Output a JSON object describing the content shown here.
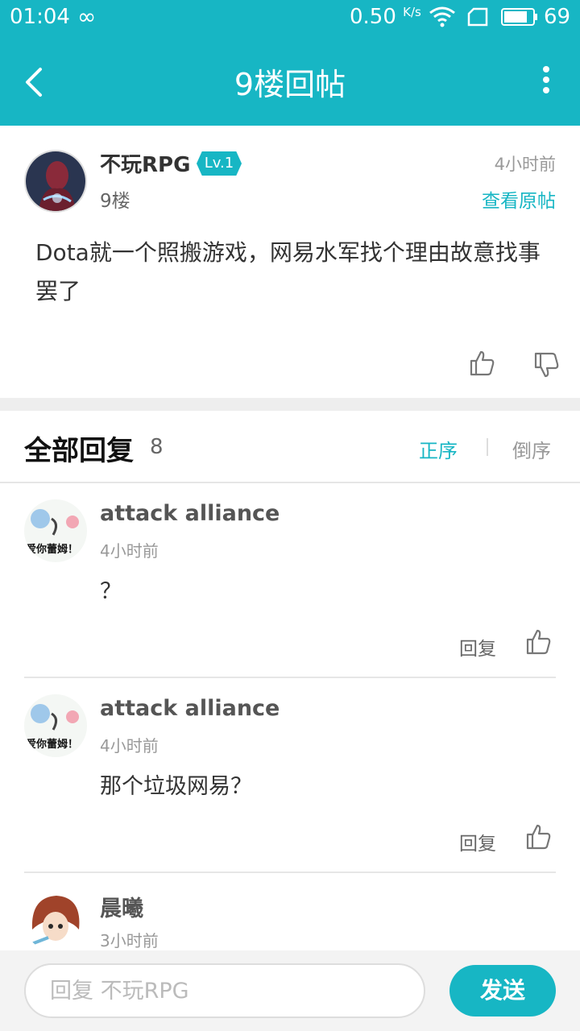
{
  "status_bar": {
    "time": "01:04",
    "net_speed": "0.50",
    "net_unit": "K/s",
    "battery": "69"
  },
  "title_bar": {
    "title": "9楼回帖"
  },
  "post": {
    "author": "不玩RPG",
    "level": "Lv.1",
    "floor": "9楼",
    "time": "4小时前",
    "view_original": "查看原帖",
    "content": "Dota就一个照搬游戏，网易水军找个理由故意找事罢了"
  },
  "replies_header": {
    "title": "全部回复",
    "count": "8",
    "sort_asc": "正序",
    "sort_desc": "倒序"
  },
  "replies": [
    {
      "name": "attack alliance",
      "time": "4小时前",
      "text": "？",
      "reply_label": "回复",
      "avatar_caption": "爱你蕾姆！"
    },
    {
      "name": "attack alliance",
      "time": "4小时前",
      "text": "那个垃圾网易？",
      "reply_label": "回复",
      "avatar_caption": "爱你蕾姆！"
    },
    {
      "name": "晨曦",
      "time": "3小时前"
    }
  ],
  "input_bar": {
    "placeholder": "回复 不玩RPG",
    "send_label": "发送"
  },
  "colors": {
    "accent": "#17b6c4",
    "divider": "#e6e6e6"
  }
}
